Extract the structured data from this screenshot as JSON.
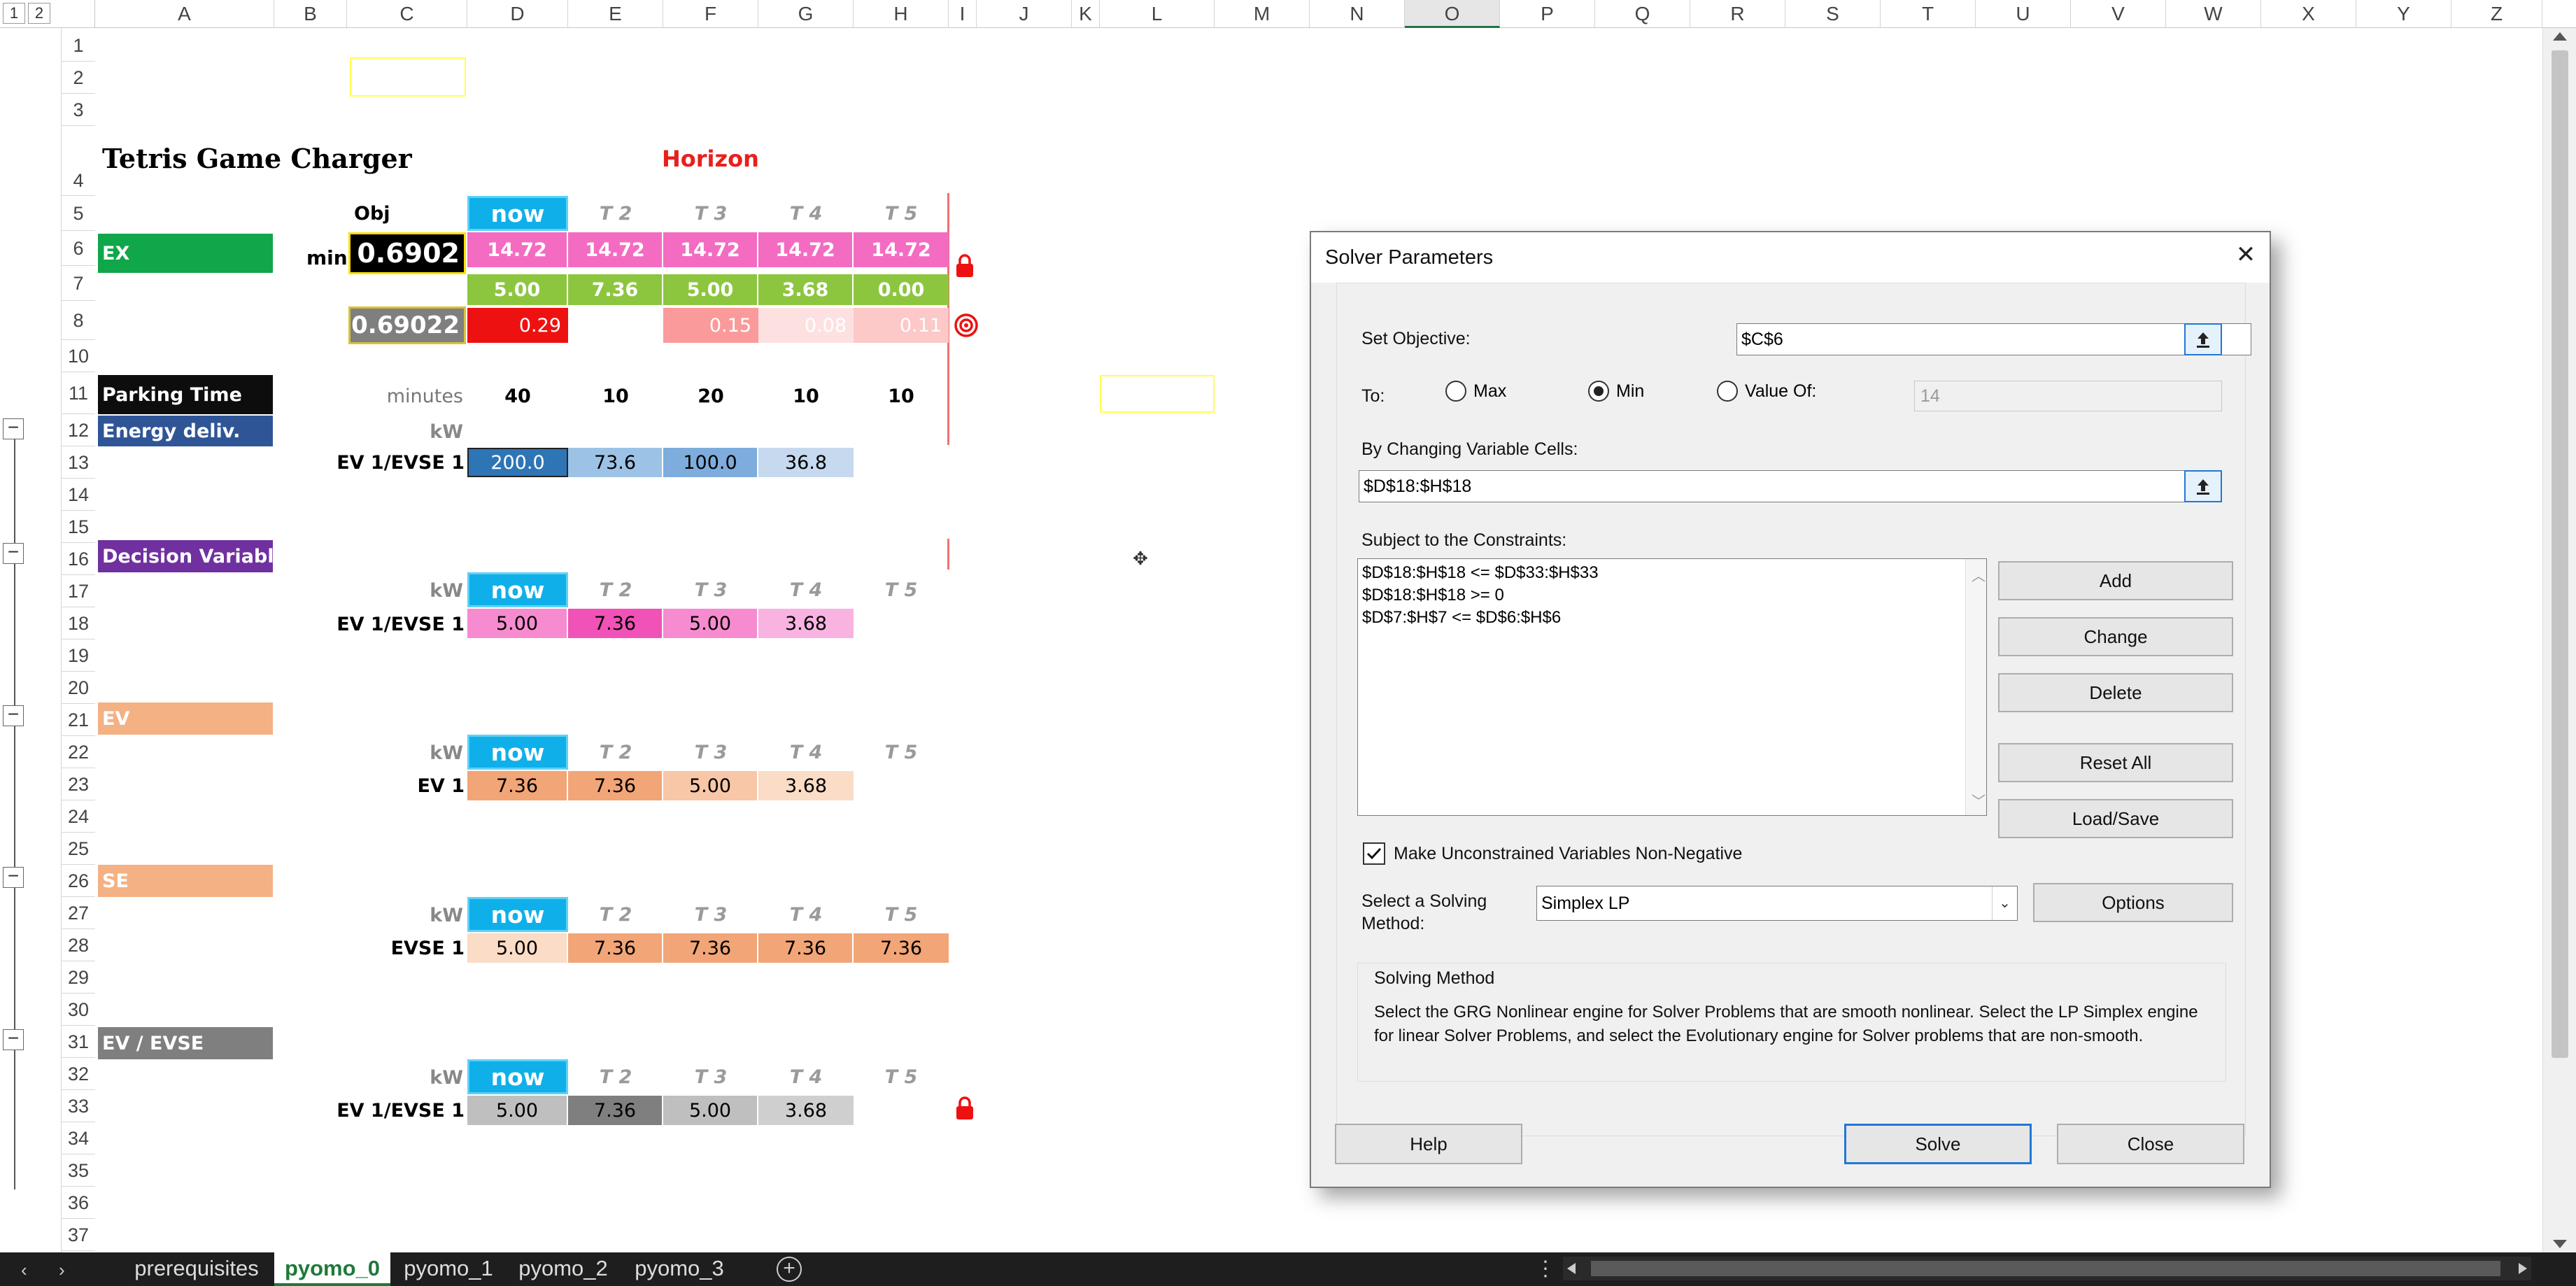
{
  "columns": [
    "A",
    "B",
    "C",
    "D",
    "E",
    "F",
    "G",
    "H",
    "I",
    "J",
    "K",
    "L",
    "M",
    "N",
    "O",
    "P",
    "Q",
    "R",
    "S",
    "T",
    "U",
    "V",
    "W",
    "X",
    "Y",
    "Z"
  ],
  "outline_levels": [
    "1",
    "2"
  ],
  "rows": [
    "1",
    "2",
    "3",
    "4",
    "5",
    "6",
    "7",
    "8",
    "10",
    "11",
    "12",
    "13",
    "14",
    "15",
    "16",
    "17",
    "18",
    "19",
    "20",
    "21",
    "22",
    "23",
    "24",
    "25",
    "26",
    "27",
    "28",
    "29",
    "30",
    "31",
    "32",
    "33",
    "34",
    "35",
    "36",
    "37"
  ],
  "sheet": {
    "title": "Tetris Game Charger",
    "horizon": "Horizon",
    "obj_label": "Obj",
    "min_label": "min",
    "obj_value": "0.6902",
    "obj_value2": "0.69022",
    "periods": [
      "now",
      "T 2",
      "T 3",
      "T 4",
      "T 5"
    ],
    "ex_label": "EX",
    "ex_row6": [
      "14.72",
      "14.72",
      "14.72",
      "14.72",
      "14.72"
    ],
    "ex_row7": [
      "5.00",
      "7.36",
      "5.00",
      "3.68",
      "0.00"
    ],
    "ex_row8": [
      "0.29",
      "",
      "0.15",
      "0.08",
      "0.11"
    ],
    "parking_label": "Parking Time",
    "minutes_label": "minutes",
    "parking_values": [
      "40",
      "10",
      "20",
      "10",
      "10"
    ],
    "energy_label": "Energy deliv.",
    "kw": "kW",
    "ev_evse_1": "EV 1/EVSE 1",
    "energy_values": [
      "200.0",
      "73.6",
      "100.0",
      "36.8"
    ],
    "decision_label": "Decision Variables",
    "decision_values": [
      "5.00",
      "7.36",
      "5.00",
      "3.68"
    ],
    "ev_label": "EV",
    "ev1": "EV 1",
    "ev_values": [
      "7.36",
      "7.36",
      "5.00",
      "3.68"
    ],
    "se_label": "SE",
    "evse1": "EVSE 1",
    "se_values": [
      "5.00",
      "7.36",
      "7.36",
      "7.36",
      "7.36"
    ],
    "evevse_label": "EV / EVSE",
    "evevse_values": [
      "5.00",
      "7.36",
      "5.00",
      "3.68"
    ]
  },
  "dialog": {
    "title": "Solver Parameters",
    "set_objective_label": "Set Objective:",
    "set_objective_value": "$C$6",
    "to_label": "To:",
    "max_label": "Max",
    "min_label": "Min",
    "value_of_label": "Value Of:",
    "value_of_value": "14",
    "changing_label": "By Changing Variable Cells:",
    "changing_value": "$D$18:$H$18",
    "constraints_label": "Subject to the Constraints:",
    "constraints": [
      "$D$18:$H$18 <= $D$33:$H$33",
      "$D$18:$H$18 >= 0",
      "$D$7:$H$7 <= $D$6:$H$6"
    ],
    "add": "Add",
    "change": "Change",
    "delete": "Delete",
    "reset_all": "Reset All",
    "load_save": "Load/Save",
    "nonneg_label": "Make Unconstrained Variables Non-Negative",
    "solving_method_label": "Select a Solving Method:",
    "method_value": "Simplex LP",
    "options": "Options",
    "solving_method_group": "Solving Method",
    "method_desc": "Select the GRG Nonlinear engine for Solver Problems that are smooth nonlinear. Select the LP Simplex engine for linear Solver Problems, and select the Evolutionary engine for Solver problems that are non-smooth.",
    "help": "Help",
    "solve": "Solve",
    "close": "Close"
  },
  "tabs": [
    "prerequisites",
    "pyomo_0",
    "pyomo_1",
    "pyomo_2",
    "pyomo_3"
  ],
  "active_tab": "pyomo_0",
  "colors": {
    "ex_green": "#10a64a",
    "parking_black": "#0d0d0d",
    "energy_blue": "#2f5597",
    "decision_purple": "#7030a0",
    "ev_salmon": "#f4b183",
    "grey": "#7f7f7f",
    "now_blue": "#0fb0ea",
    "active_tab_green": "#1f7a3a"
  }
}
